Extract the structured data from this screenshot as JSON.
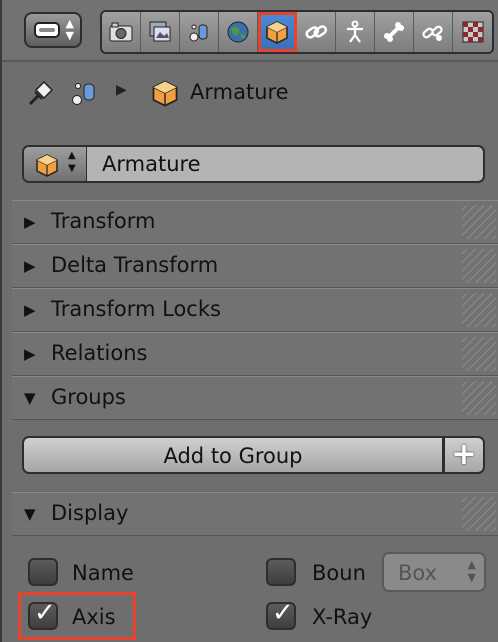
{
  "header": {
    "object_name": "Armature"
  },
  "name_field": {
    "value": "Armature"
  },
  "tabs": [
    {
      "icon": "render-icon"
    },
    {
      "icon": "render-layers-icon"
    },
    {
      "icon": "scene-icon"
    },
    {
      "icon": "world-icon"
    },
    {
      "icon": "object-icon",
      "active": true
    },
    {
      "icon": "constraints-icon"
    },
    {
      "icon": "armature-data-icon"
    },
    {
      "icon": "bone-icon"
    },
    {
      "icon": "bone-constraints-icon"
    },
    {
      "icon": "texture-icon"
    }
  ],
  "panels": {
    "transform": "Transform",
    "delta_transform": "Delta Transform",
    "transform_locks": "Transform Locks",
    "relations": "Relations",
    "groups": "Groups",
    "display": "Display"
  },
  "groups": {
    "add_to_group": "Add to Group",
    "add_icon": "+"
  },
  "display": {
    "name": {
      "label": "Name",
      "checked": false
    },
    "bounds": {
      "label": "Boun",
      "checked": false
    },
    "bounds_type": {
      "value": "Box"
    },
    "axis": {
      "label": "Axis",
      "checked": true
    },
    "xray": {
      "label": "X-Ray",
      "checked": true
    }
  },
  "colors": {
    "active_tab": "#3a6fb8",
    "highlight": "#e8412c",
    "object_orange": "#f0a040"
  }
}
